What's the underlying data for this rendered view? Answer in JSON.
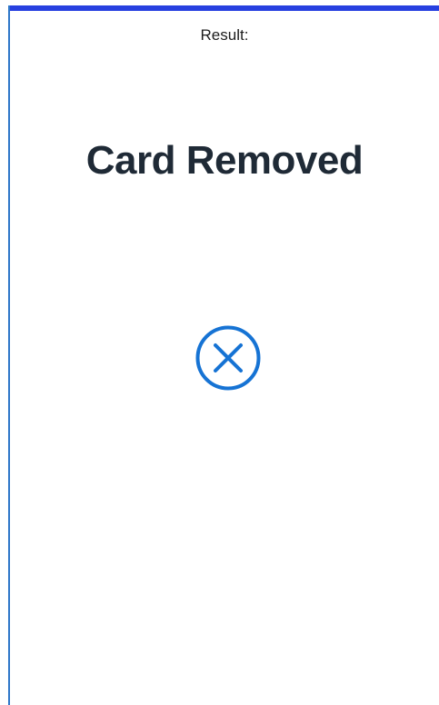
{
  "result": {
    "label": "Result:",
    "title": "Card Removed",
    "status_icon": "close-circle-icon"
  },
  "colors": {
    "accent_top_bar": "#2740e0",
    "left_edge": "#2f77c9",
    "icon": "#1673d4",
    "title_text": "#1f2a36",
    "label_text": "#1c1c1c"
  }
}
